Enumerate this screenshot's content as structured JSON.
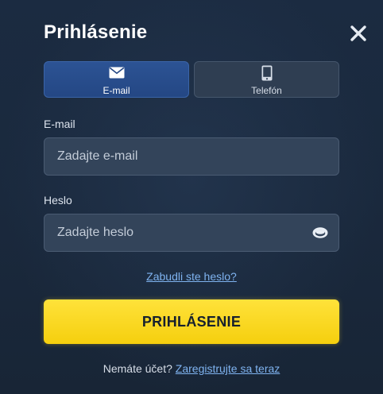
{
  "modal": {
    "title": "Prihlásenie",
    "close_icon": "close-icon"
  },
  "tabs": [
    {
      "label": "E-mail",
      "icon": "envelope-icon",
      "active": true
    },
    {
      "label": "Telefón",
      "icon": "phone-icon",
      "active": false
    }
  ],
  "email": {
    "label": "E-mail",
    "placeholder": "Zadajte e-mail",
    "value": ""
  },
  "password": {
    "label": "Heslo",
    "placeholder": "Zadajte heslo",
    "value": "",
    "toggle_icon": "eye-icon"
  },
  "forgot_link": "Zabudli ste heslo?",
  "submit_label": "PRIHLÁSENIE",
  "footer": {
    "prompt": "Nemáte účet?",
    "register_link": "Zaregistrujte sa teraz"
  },
  "colors": {
    "background": "#1a2a3f",
    "tab_active": "#2c5394",
    "input_bg": "#33445a",
    "link": "#7fb3f0",
    "submit": "#f5cf0e"
  }
}
